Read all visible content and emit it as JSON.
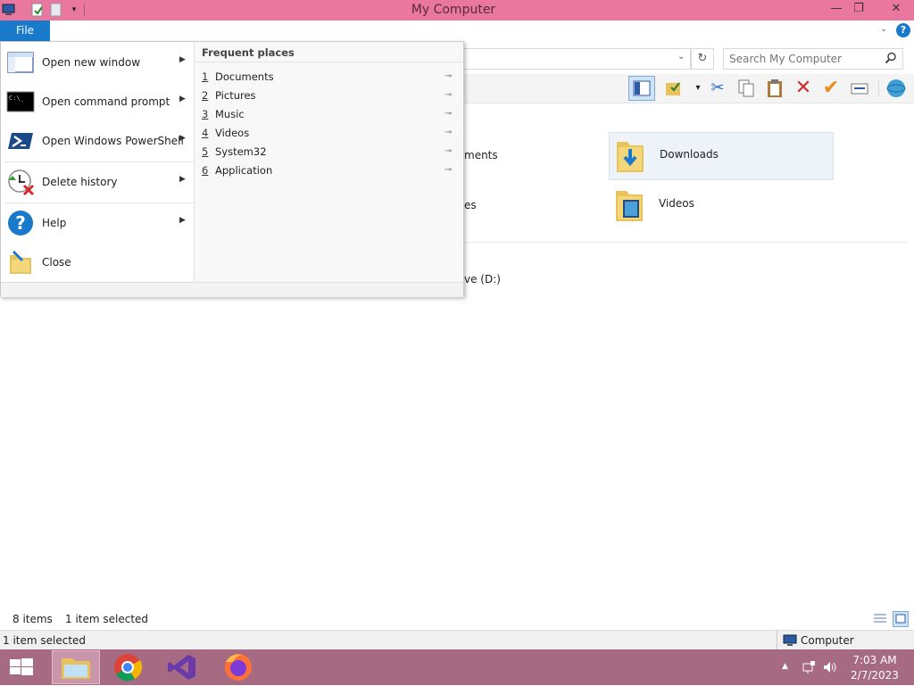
{
  "window": {
    "title": "My Computer"
  },
  "file_menu": {
    "tab_label": "File",
    "items": [
      {
        "label": "Open new window",
        "icon": "window-icon"
      },
      {
        "label": "Open command prompt",
        "icon": "cmd-icon"
      },
      {
        "label": "Open Windows PowerShell",
        "icon": "powershell-icon"
      },
      {
        "label": "Delete history",
        "icon": "delete-history-icon"
      },
      {
        "label": "Help",
        "icon": "help-icon"
      },
      {
        "label": "Close",
        "icon": "close-folder-icon"
      }
    ],
    "frequent_header": "Frequent places",
    "frequent": [
      {
        "num": "1",
        "label": "Documents"
      },
      {
        "num": "2",
        "label": "Pictures"
      },
      {
        "num": "3",
        "label": "Music"
      },
      {
        "num": "4",
        "label": "Videos"
      },
      {
        "num": "5",
        "label": "System32"
      },
      {
        "num": "6",
        "label": "Application"
      }
    ]
  },
  "search": {
    "placeholder": "Search My Computer"
  },
  "content": {
    "tiles": [
      {
        "label": "Downloads",
        "selected": true
      },
      {
        "label": "Videos",
        "selected": false
      }
    ],
    "partial_labels": [
      "ments",
      "es",
      "ve (D:)"
    ]
  },
  "status": {
    "items_count": "8 items",
    "selected": "1 item selected",
    "bottom_selected": "1 item selected",
    "zone": "Computer"
  },
  "taskbar": {
    "time": "7:03 AM",
    "date": "2/7/2023",
    "apps": [
      "file-explorer-icon",
      "chrome-icon",
      "visual-studio-icon",
      "firefox-icon"
    ]
  },
  "colors": {
    "title_bar": "#e9779e",
    "file_tab": "#1979ca",
    "taskbar": "#a66b83"
  }
}
